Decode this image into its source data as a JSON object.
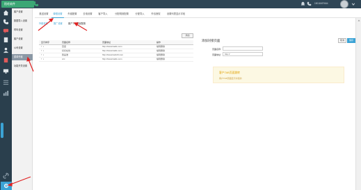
{
  "header": {
    "logo_text": "阳毛软件",
    "username": "15018497664"
  },
  "submenu": {
    "items": [
      {
        "label": "客户设置"
      },
      {
        "label": "数据导入设置"
      },
      {
        "label": "呼叫设置"
      },
      {
        "label": "客户设置"
      },
      {
        "label": "公司设置"
      },
      {
        "label": "菜单外链"
      },
      {
        "label": "功能开关设置"
      }
    ],
    "active_index": 5
  },
  "tabs": {
    "items": [
      "推送设置",
      "弹框设置",
      "外链配置",
      "去电设置",
      "客户导入",
      "分配规则配置",
      "分配导入",
      "外包授权",
      "设置列表显示字段"
    ],
    "active_index": 1
  },
  "subtabs": {
    "items": [
      "外链设置",
      "推广设置",
      "客户TAB页面配置"
    ],
    "active_index": 2
  },
  "table": {
    "add_label": "添加",
    "headers": [
      "显示排序",
      "页面名称",
      "页面地址",
      "操作"
    ],
    "rows": [
      {
        "name": "百度",
        "url": "http://www.baidu.com",
        "op": "编辑删除"
      },
      {
        "name": "好好在线",
        "url": "http://www.baidu.com",
        "op": "编辑删除"
      },
      {
        "name": "我是谁",
        "url": "http://www.bai123.com",
        "op": "编辑删除"
      },
      {
        "name": "ccc",
        "url": "http://www.baidu.com",
        "op": "编辑删除"
      }
    ]
  },
  "form": {
    "title": "添加对接页面",
    "cancel_label": "取消",
    "save_label": "保存",
    "name_label": "页面名称:",
    "name_value": "",
    "url_label": "页面地址:",
    "url_value": "http://"
  },
  "notice": {
    "title": "客户TAB页面跳转",
    "desc": "客户TAB页面显示对接的"
  },
  "colors": {
    "topbar": "#2f4656",
    "accent": "#3ba3d5",
    "brand_green": "#3ba775",
    "annotation": "#e02020"
  }
}
